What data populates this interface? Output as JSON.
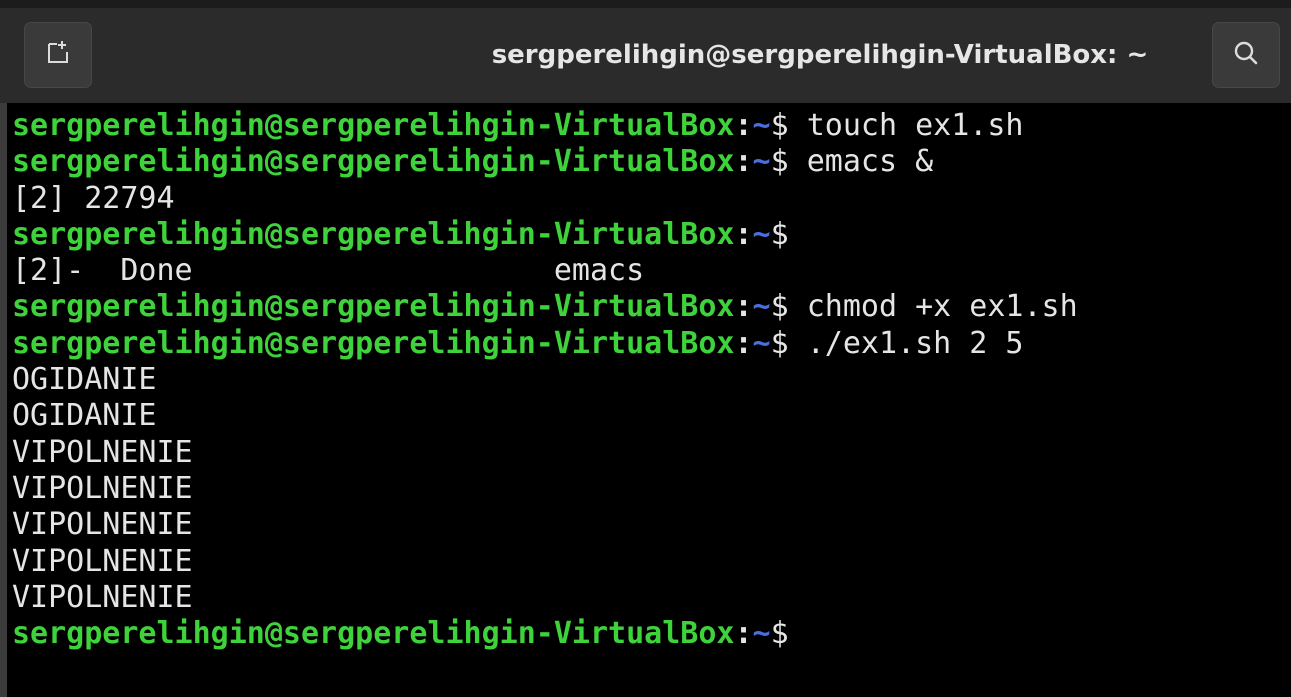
{
  "window": {
    "title": "sergperelihgin@sergperelihgin-VirtualBox: ~",
    "new_tab_icon": "new-tab-icon",
    "search_icon": "search-icon"
  },
  "colors": {
    "prompt_user": "#3fd33b",
    "prompt_path": "#4a6fe0",
    "text": "#e5e5e5",
    "background": "#000000",
    "titlebar": "#2b2b2b"
  },
  "terminal": {
    "lines": [
      {
        "type": "prompt",
        "user": "sergperelihgin@sergperelihgin-VirtualBox",
        "colon": ":",
        "path": "~",
        "dollar": "$",
        "command": " touch ex1.sh"
      },
      {
        "type": "prompt",
        "user": "sergperelihgin@sergperelihgin-VirtualBox",
        "colon": ":",
        "path": "~",
        "dollar": "$",
        "command": " emacs &"
      },
      {
        "type": "output",
        "text": "[2] 22794"
      },
      {
        "type": "prompt",
        "user": "sergperelihgin@sergperelihgin-VirtualBox",
        "colon": ":",
        "path": "~",
        "dollar": "$",
        "command": ""
      },
      {
        "type": "output",
        "text": "[2]-  Done                    emacs"
      },
      {
        "type": "prompt",
        "user": "sergperelihgin@sergperelihgin-VirtualBox",
        "colon": ":",
        "path": "~",
        "dollar": "$",
        "command": " chmod +x ex1.sh"
      },
      {
        "type": "prompt",
        "user": "sergperelihgin@sergperelihgin-VirtualBox",
        "colon": ":",
        "path": "~",
        "dollar": "$",
        "command": " ./ex1.sh 2 5"
      },
      {
        "type": "output",
        "text": "OGIDANIE"
      },
      {
        "type": "output",
        "text": "OGIDANIE"
      },
      {
        "type": "output",
        "text": "VIPOLNENIE"
      },
      {
        "type": "output",
        "text": "VIPOLNENIE"
      },
      {
        "type": "output",
        "text": "VIPOLNENIE"
      },
      {
        "type": "output",
        "text": "VIPOLNENIE"
      },
      {
        "type": "output",
        "text": "VIPOLNENIE"
      },
      {
        "type": "prompt",
        "user": "sergperelihgin@sergperelihgin-VirtualBox",
        "colon": ":",
        "path": "~",
        "dollar": "$",
        "command": ""
      }
    ]
  }
}
